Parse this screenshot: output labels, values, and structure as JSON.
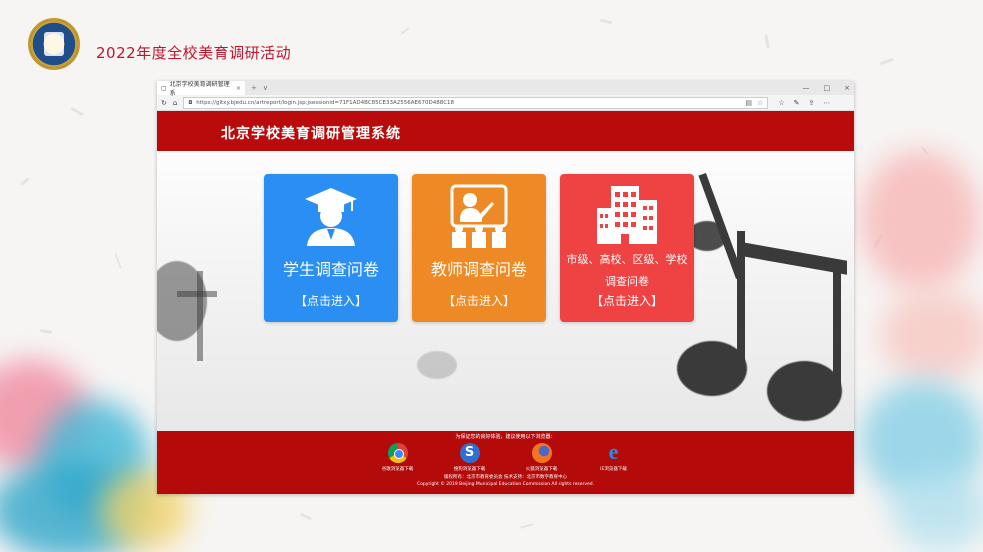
{
  "slide": {
    "title": "2022年度全校美育调研活动"
  },
  "browser": {
    "tab_title": "北京学校美育调研管理系",
    "tab_close": "×",
    "new_tab": "+",
    "tab_menu": "∨",
    "win_min": "—",
    "win_max": "□",
    "win_close": "×",
    "url": "https://gltxy.bjedu.cn/artreport/login.jsp;jsessionid=71F1AD4BC85CE33A2556AE670D488C18",
    "back": "↻",
    "home": "⌂",
    "lock": "🔒",
    "reader": "▤",
    "star": "☆",
    "fav": "☆",
    "pen": "✎",
    "share": "⇪",
    "more": "⋯"
  },
  "site": {
    "header_title": "北京学校美育调研管理系统",
    "cards": [
      {
        "label": "学生调查问卷",
        "enter": "【点击进入】",
        "color": "#2a8ef2",
        "icon": "student-graduate-icon"
      },
      {
        "label": "教师调查问卷",
        "enter": "【点击进入】",
        "color": "#ee8a25",
        "icon": "teacher-board-icon"
      },
      {
        "label_line1": "市级、高校、区级、学校",
        "label_line2": "调查问卷",
        "enter": "【点击进入】",
        "color": "#ef4242",
        "icon": "school-building-icon"
      }
    ],
    "footer": {
      "tip": "为保证您的良好体验，建议使用以下浏览器：",
      "browsers": [
        {
          "name": "谷歌浏览器下载",
          "icon": "chrome-icon"
        },
        {
          "name": "搜狗浏览器下载",
          "icon": "sogou-icon"
        },
        {
          "name": "火狐浏览器下载",
          "icon": "firefox-icon"
        },
        {
          "name": "IE浏览器下载",
          "icon": "ie-icon"
        }
      ],
      "org": "版权所有：北京市教育委员会 技术支持：北京市数字教育中心",
      "copyright": "Copyright © 2019 Beijing Municipal Education Commission.All rights reserved."
    }
  },
  "colors": {
    "title_red": "#c0162d",
    "header_red": "#b90b0b"
  }
}
